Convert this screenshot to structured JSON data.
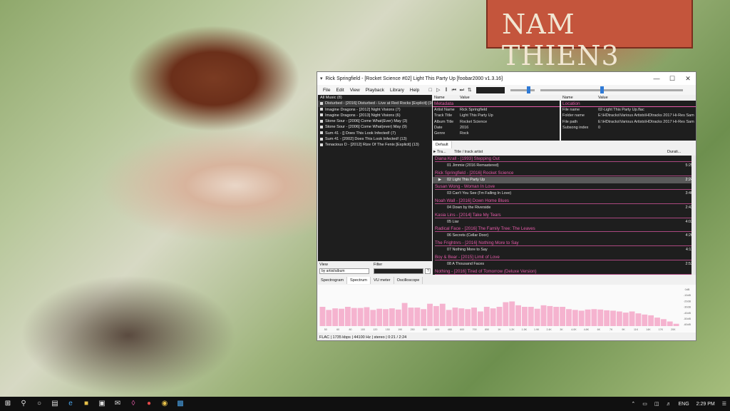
{
  "wallpaper": {
    "sign_text": "NAM THIEN3"
  },
  "window": {
    "title": "Rick Springfield - [Rocket Science #02] Light This Party Up   [foobar2000 v1.3.16]",
    "menu": [
      "File",
      "Edit",
      "View",
      "Playback",
      "Library",
      "Help"
    ],
    "volume_level": 0.68,
    "seek_level": 0.42
  },
  "library": {
    "items": [
      "All Music (8)",
      "Disturbed - [2016] Disturbed - Live at Red Rocks [Explicit] (16)",
      "Imagine Dragons - [2012] Night Visions (7)",
      "Imagine Dragons - [2013] Night Visions (6)",
      "Stone Sour - [2006] Come What(Ever) May (3)",
      "Stone Sour - [2006] Come What(ever) May (9)",
      "Sum 41 - [] Does This Look Infected! (7)",
      "Sum 41 - [2002] Does This Look Infected! (13)",
      "Tenacious D - [2012] Rize Of The Fenix [Explicit] (13)"
    ],
    "view_label": "View",
    "view_value": "by artist/album",
    "filter_label": "Filter",
    "help_btn": "?"
  },
  "props_left": {
    "col_name": "Name",
    "col_value": "Value",
    "section": "Metadata",
    "rows": [
      {
        "k": "Artist Name",
        "v": "Rick Springfield"
      },
      {
        "k": "Track Title",
        "v": "Light This Party Up"
      },
      {
        "k": "Album Title",
        "v": "Rocket Science"
      },
      {
        "k": "Date",
        "v": "2016"
      },
      {
        "k": "Genre",
        "v": "Rock"
      }
    ]
  },
  "props_right": {
    "col_name": "Name",
    "col_value": "Value",
    "section": "Location",
    "rows": [
      {
        "k": "File name",
        "v": "02-Light This Party Up.flac"
      },
      {
        "k": "Folder name",
        "v": "E:\\HDtracks\\Various Artists\\HDtracks 2017 Hi-Res Sam"
      },
      {
        "k": "File path",
        "v": "E:\\HDtracks\\Various Artists\\HDtracks 2017 Hi-Res Sam"
      },
      {
        "k": "Subsong index",
        "v": "0"
      }
    ]
  },
  "playlist": {
    "tab": "Default",
    "col_track": "Tra...",
    "col_title": "Title / track artist",
    "col_duration": "Durati...",
    "groups": [
      {
        "header": "Diana Krall - [1993] Stepping Out",
        "track": "01  Jimmie (2016 Remastered)",
        "duration": "5:25"
      },
      {
        "header": "Rick Springfield - [2016] Rocket Science",
        "track": "02  Light This Party Up",
        "duration": "2:24",
        "now": true
      },
      {
        "header": "Susan Wong - Woman In Love",
        "track": "03  Can't You See (I'm Falling In Love)",
        "duration": "3:40"
      },
      {
        "header": "Noah Wall - [2016] Down Home Blues",
        "track": "04  Down by the Riverside",
        "duration": "2:42"
      },
      {
        "header": "Kasia Lins - [2014] Take My Tears",
        "track": "05  Liar",
        "duration": "4:03"
      },
      {
        "header": "Radical Face - [2016] The Family Tree: The Leaves",
        "track": "06  Secrets (Cellar Door)",
        "duration": "4:26"
      },
      {
        "header": "The Frightnrs - [2016] Nothing More to Say",
        "track": "07  Nothing More to Say",
        "duration": "4:11"
      },
      {
        "header": "Boy & Bear - [2015] Limit of Love",
        "track": "08  A Thousand Faces",
        "duration": "2:53"
      },
      {
        "header": "Nothing - [2016] Tired of Tomorrow (Deluxe Version)",
        "track": "",
        "duration": ""
      }
    ]
  },
  "viz_tabs": [
    "Spectrogram",
    "Spectrum",
    "VU meter",
    "Oscilloscope"
  ],
  "spectrum": {
    "color": "#f5b3cf",
    "levels": [
      0.5,
      0.42,
      0.46,
      0.45,
      0.5,
      0.47,
      0.47,
      0.49,
      0.42,
      0.45,
      0.44,
      0.46,
      0.43,
      0.6,
      0.48,
      0.48,
      0.44,
      0.58,
      0.52,
      0.58,
      0.42,
      0.48,
      0.46,
      0.44,
      0.48,
      0.38,
      0.5,
      0.46,
      0.5,
      0.62,
      0.64,
      0.54,
      0.5,
      0.5,
      0.45,
      0.54,
      0.52,
      0.5,
      0.5,
      0.44,
      0.42,
      0.4,
      0.43,
      0.44,
      0.43,
      0.41,
      0.4,
      0.38,
      0.35,
      0.38,
      0.33,
      0.3,
      0.28,
      0.22,
      0.18,
      0.12,
      0.06
    ],
    "ticks": [
      "50",
      "60",
      "80",
      "100",
      "120",
      "150",
      "190",
      "250",
      "300",
      "400",
      "480",
      "600",
      "700",
      "850",
      "1K",
      "1.2K",
      "1.5K",
      "1.9K",
      "2.4K",
      "3K",
      "4.0K",
      "4.8K",
      "6K",
      "7K",
      "9K",
      "11K",
      "14K",
      "17K",
      "20K"
    ],
    "db_labels": [
      "0dB",
      "-10dB",
      "-20dB",
      "-30dB",
      "-40dB",
      "-50dB",
      "-60dB"
    ]
  },
  "status": "FLAC | 1735 kbps | 44100 Hz | stereo | 0:21 / 2:24",
  "taskbar": {
    "lang": "ENG",
    "time": "2:29 PM"
  }
}
